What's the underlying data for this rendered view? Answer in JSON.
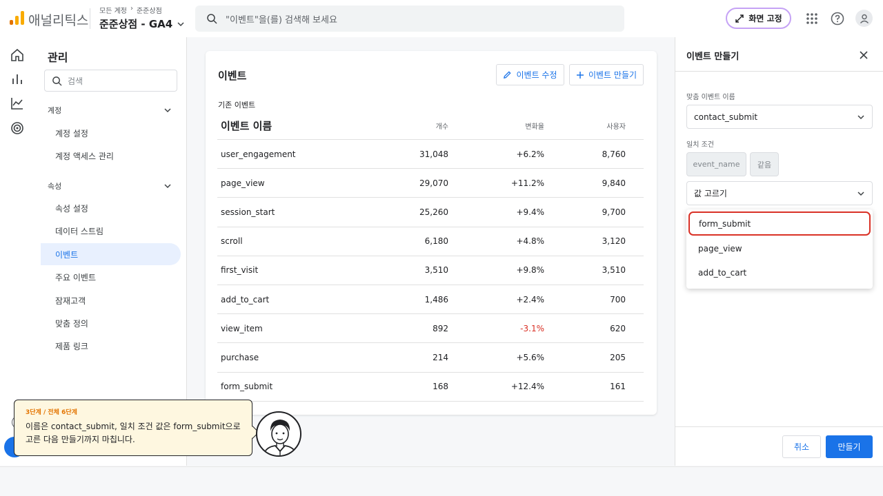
{
  "header": {
    "app_name": "애널리틱스",
    "breadcrumb": [
      "모든 계정",
      "준준상점"
    ],
    "property": "준준상점 - GA4",
    "search_placeholder": "\"이벤트\"을(를) 검색해 보세요",
    "pin_label": "화면 고정",
    "brand_colors": [
      "#f9ab00",
      "#e37400"
    ]
  },
  "nav": {
    "title": "관리",
    "search_placeholder": "검색",
    "account_section": "계정",
    "account_items": [
      "계정 설정",
      "계정 액세스 관리"
    ],
    "property_section": "속성",
    "property_items": [
      "속성 설정",
      "데이터 스트림",
      "이벤트",
      "주요 이벤트",
      "잠재고객",
      "맞춤 정의",
      "제품 링크"
    ],
    "active_item": "이벤트"
  },
  "main": {
    "title": "이벤트",
    "edit_button": "이벤트 수정",
    "create_button": "이벤트 만들기",
    "subheading": "기존 이벤트",
    "columns": [
      "이벤트 이름",
      "개수",
      "변화율",
      "사용자"
    ],
    "rows": [
      {
        "name": "user_engagement",
        "count": "31,048",
        "change": "+6.2%",
        "users": "8,760"
      },
      {
        "name": "page_view",
        "count": "29,070",
        "change": "+11.2%",
        "users": "9,840"
      },
      {
        "name": "session_start",
        "count": "25,260",
        "change": "+9.4%",
        "users": "9,700"
      },
      {
        "name": "scroll",
        "count": "6,180",
        "change": "+4.8%",
        "users": "3,120"
      },
      {
        "name": "first_visit",
        "count": "3,510",
        "change": "+9.8%",
        "users": "3,510"
      },
      {
        "name": "add_to_cart",
        "count": "1,486",
        "change": "+2.4%",
        "users": "700"
      },
      {
        "name": "view_item",
        "count": "892",
        "change": "-3.1%",
        "users": "620"
      },
      {
        "name": "purchase",
        "count": "214",
        "change": "+5.6%",
        "users": "205"
      },
      {
        "name": "form_submit",
        "count": "168",
        "change": "+12.4%",
        "users": "161"
      }
    ]
  },
  "panel": {
    "title": "이벤트 만들기",
    "custom_name_label": "맞춤 이벤트 이름",
    "custom_name_value": "contact_submit",
    "condition_label": "일치 조건",
    "condition_param": "event_name",
    "condition_operator": "같음",
    "value_placeholder": "값 고르기",
    "options": [
      "form_submit",
      "page_view",
      "add_to_cart"
    ],
    "highlighted_option": "form_submit",
    "cancel_button": "취소",
    "create_button": "만들기"
  },
  "tour": {
    "step": "3단계 / 전체 6단계",
    "message": "이름은 contact_submit, 일치 조건 값은 form_submit으로 고른 다음 만들기까지 마칩니다."
  }
}
